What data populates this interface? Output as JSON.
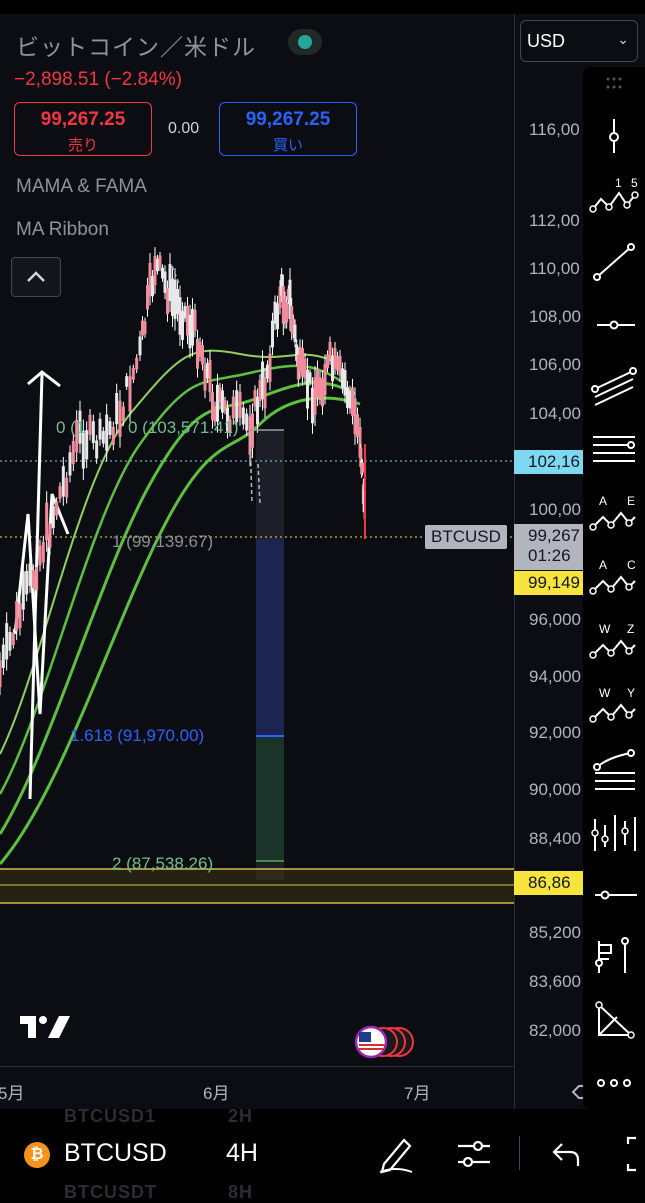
{
  "header": {
    "title": "ビットコイン／米ドル",
    "change": "−2,898.51 (−2.84%)",
    "sell_price": "99,267.25",
    "sell_label": "売り",
    "spread": "0.00",
    "buy_price": "99,267.25",
    "buy_label": "買い",
    "indicators": [
      "MAMA & FAMA",
      "MA Ribbon"
    ],
    "currency": "USD",
    "live_indicator_color": "#26a69a"
  },
  "price_axis": {
    "ticks": [
      "116,00",
      "112,00",
      "110,00",
      "108,00",
      "106,00",
      "104,00",
      "100,00",
      "96,000",
      "94,000",
      "92,000",
      "90,000",
      "88,400",
      "85,200",
      "83,600",
      "82,000"
    ],
    "tags": {
      "last_close": "102,16",
      "current_price": "99,267",
      "countdown": "01:26",
      "level_1": "99,149",
      "level_2": "86,86"
    },
    "symbol_tag": "BTCUSD"
  },
  "fib_levels": {
    "level_0": "0 (103,571.41)",
    "level_0_ghost": "0 (1",
    "level_1": "1 (99,139.67)",
    "level_1618": "1.618 (91,970.00)",
    "level_2": "2 (87,538.26)"
  },
  "time_axis": {
    "labels": [
      "5月",
      "6月",
      "7月"
    ]
  },
  "bottom_bar": {
    "symbol": "BTCUSD",
    "interval": "4H",
    "ghost_items": [
      "BTCUSD1",
      "2H",
      "BTCUSDT",
      "8H"
    ]
  },
  "toolbar": {
    "tools": [
      "vertical-ray-icon",
      "elliott-impulse-icon",
      "trend-line-icon",
      "horizontal-ray-icon",
      "parallel-channel-icon",
      "horizontal-lines-icon",
      "pattern-ae-icon",
      "pattern-ac-icon",
      "pattern-wz-icon",
      "pattern-wy-icon",
      "fib-retracement-icon",
      "gann-fan-icon",
      "horizontal-line-icon",
      "measure-icon",
      "triangle-icon",
      "more-icon"
    ],
    "labels": {
      "impulse_a": "1",
      "impulse_b": "5",
      "ae_a": "A",
      "ae_b": "E",
      "ac_a": "A",
      "ac_b": "C",
      "wz_a": "W",
      "wz_b": "Z",
      "wy_a": "W",
      "wy_b": "Y"
    }
  },
  "colors": {
    "down": "#f23645",
    "up": "#26a69a",
    "buy": "#2962ff",
    "ma_green": "#4caf50",
    "highlight_yellow": "#f7e43d",
    "cyan_tag": "#7fd8f2"
  }
}
